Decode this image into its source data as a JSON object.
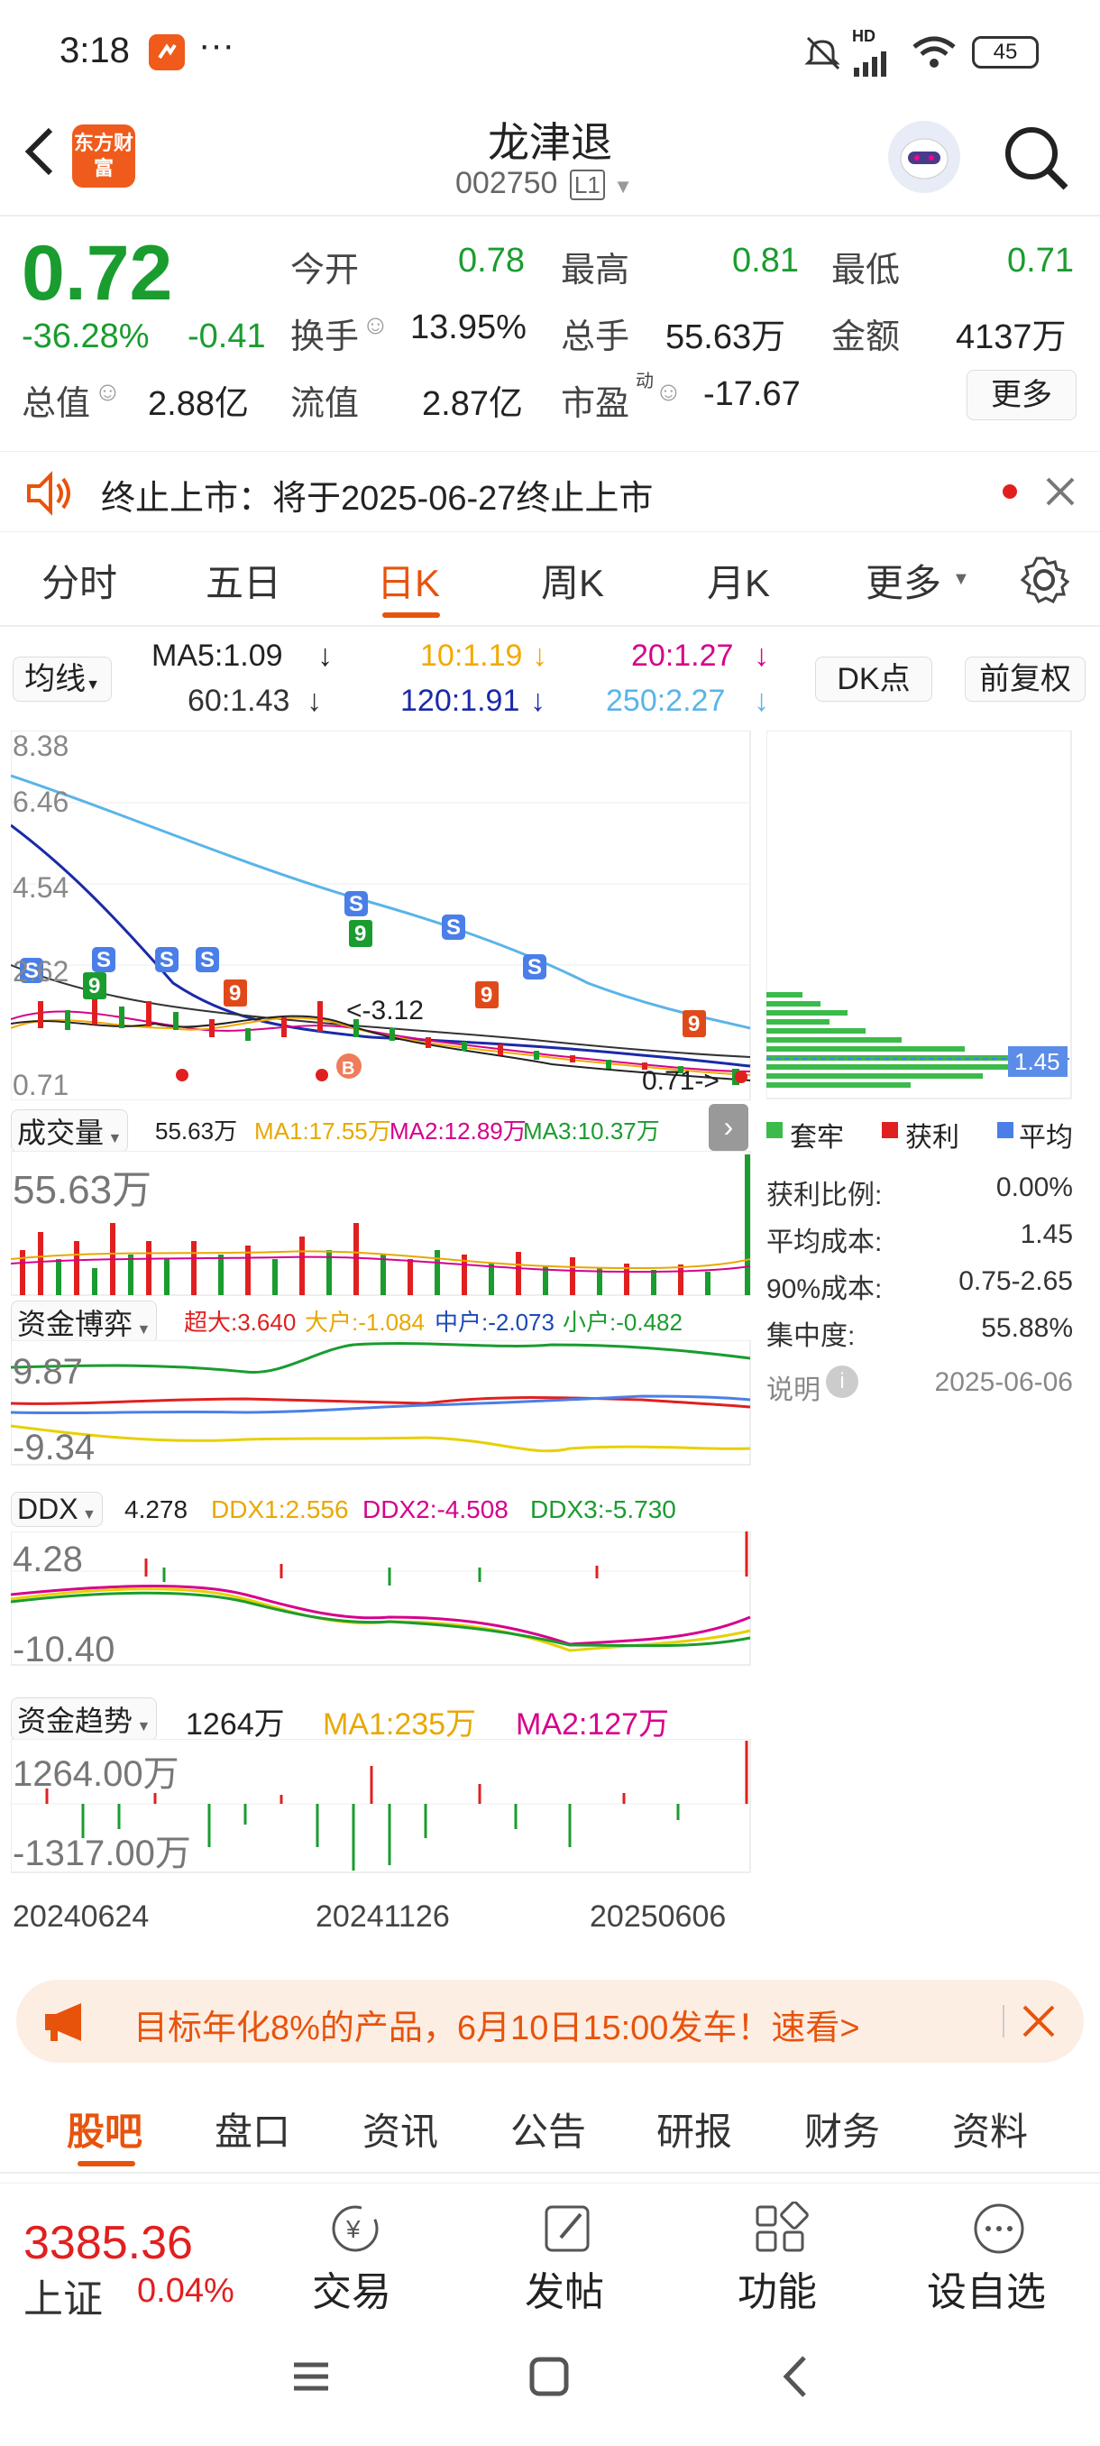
{
  "status_bar": {
    "time": "3:18",
    "network": "HD",
    "battery": "45"
  },
  "header": {
    "title": "龙津退",
    "code": "002750",
    "level_badge": "L1",
    "brand_logo": "东方财富"
  },
  "quote": {
    "price": "0.72",
    "change_pct": "-36.28%",
    "change": "-0.41",
    "fields": [
      {
        "label": "今开",
        "value": "0.78"
      },
      {
        "label": "最高",
        "value": "0.81"
      },
      {
        "label": "最低",
        "value": "0.71"
      },
      {
        "label": "换手",
        "value": "13.95%"
      },
      {
        "label": "总手",
        "value": "55.63万"
      },
      {
        "label": "金额",
        "value": "4137万"
      },
      {
        "label": "总值",
        "value": "2.88亿"
      },
      {
        "label": "流值",
        "value": "2.87亿"
      },
      {
        "label": "市盈",
        "value": "-17.67",
        "sup": "动"
      }
    ],
    "more_button": "更多"
  },
  "notice": {
    "text": "终止上市：将于2025-06-27终止上市"
  },
  "tabs": [
    {
      "label": "分时"
    },
    {
      "label": "五日"
    },
    {
      "label": "日K",
      "active": true
    },
    {
      "label": "周K"
    },
    {
      "label": "月K"
    },
    {
      "label": "更多"
    }
  ],
  "ma_bar": {
    "selector": "均线",
    "ma5": "MA5:1.09",
    "ma10": "10:1.19",
    "ma20": "20:1.27",
    "ma60": "60:1.43",
    "ma120": "120:1.91",
    "ma250": "250:2.27",
    "dk_button": "DK点",
    "adjust_button": "前复权"
  },
  "colors": {
    "ma5": "#222222",
    "ma10": "#f2a900",
    "ma20": "#d6008c",
    "ma60": "#333333",
    "ma120": "#1a2aa8",
    "ma250": "#5ab4e8",
    "up": "#e02020",
    "down": "#1a9c2f",
    "accent": "#e8530c"
  },
  "kline": {
    "y_labels": [
      "8.38",
      "6.46",
      "4.54",
      "2.62",
      "0.71"
    ],
    "annotation_high": "<-3.12",
    "annotation_low": "0.71->",
    "markers": [
      "S",
      "S",
      "S",
      "S",
      "9",
      "9",
      "9",
      "9",
      "B"
    ]
  },
  "volume": {
    "selector": "成交量",
    "vol": "55.63万",
    "ma1": "MA1:17.55万",
    "ma2": "MA2:12.89万",
    "ma3": "MA3:10.37万",
    "label": "55.63万"
  },
  "fund_game": {
    "selector": "资金博弈",
    "super": "超大:3.640",
    "large": "大户:-1.084",
    "mid": "中户:-2.073",
    "small": "小户:-0.482",
    "top": "9.87",
    "bottom": "-9.34"
  },
  "ddx": {
    "selector": "DDX",
    "value": "4.278",
    "ddx1": "DDX1:2.556",
    "ddx2": "DDX2:-4.508",
    "ddx3": "DDX3:-5.730",
    "top": "4.28",
    "bottom": "-10.40"
  },
  "fund_trend": {
    "selector": "资金趋势",
    "value": "1264万",
    "ma1": "MA1:235万",
    "ma2": "MA2:127万",
    "top": "1264.00万",
    "bottom": "-1317.00万"
  },
  "dates": [
    "20240624",
    "20241126",
    "20250606"
  ],
  "distribution": {
    "price_label": "1.45",
    "legend": [
      "套牢",
      "获利",
      "平均"
    ],
    "rows": [
      {
        "label": "获利比例:",
        "value": "0.00%"
      },
      {
        "label": "平均成本:",
        "value": "1.45"
      },
      {
        "label": "90%成本:",
        "value": "0.75-2.65"
      },
      {
        "label": "集中度:",
        "value": "55.88%"
      }
    ],
    "note_label": "说明",
    "note_date": "2025-06-06"
  },
  "promo": {
    "text": "目标年化8%的产品，6月10日15:00发车！速看>"
  },
  "bottom_tabs": [
    {
      "label": "股吧",
      "active": true
    },
    {
      "label": "盘口"
    },
    {
      "label": "资讯"
    },
    {
      "label": "公告"
    },
    {
      "label": "研报"
    },
    {
      "label": "财务"
    },
    {
      "label": "资料"
    }
  ],
  "dock": {
    "index_value": "3385.36",
    "index_name": "上证",
    "index_pct": "0.04%",
    "items": [
      {
        "label": "交易",
        "icon": "yuan-cycle-icon"
      },
      {
        "label": "发帖",
        "icon": "edit-icon"
      },
      {
        "label": "功能",
        "icon": "grid-icon"
      },
      {
        "label": "设自选",
        "icon": "more-dots-icon"
      }
    ]
  }
}
